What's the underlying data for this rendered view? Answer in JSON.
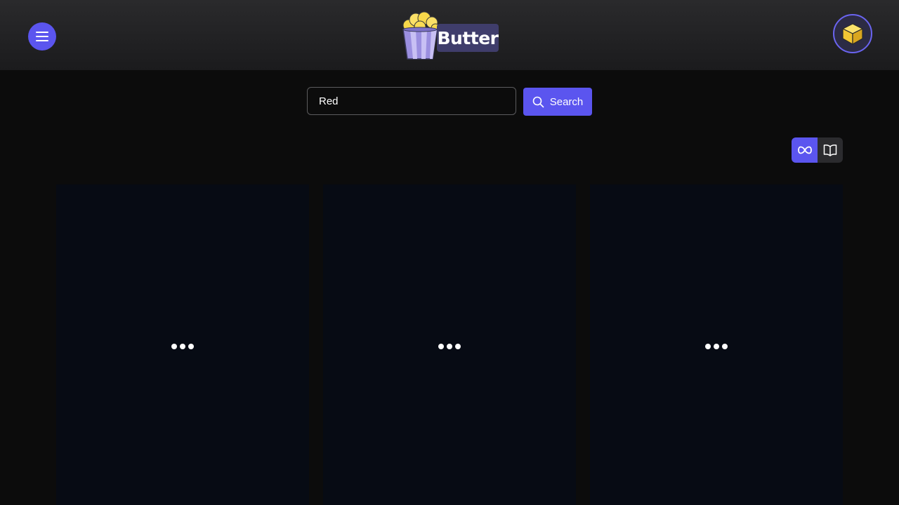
{
  "header": {
    "brand": "Butter",
    "menu_icon": "hamburger-menu-icon",
    "logo_icon": "popcorn-bucket-icon",
    "profile_icon": "cube-icon"
  },
  "search": {
    "value": "Red",
    "placeholder": "",
    "button_label": "Search",
    "button_icon": "search-icon"
  },
  "view_modes": [
    {
      "name": "infinite-scroll",
      "icon": "infinity-icon",
      "active": true
    },
    {
      "name": "paged",
      "icon": "book-icon",
      "active": false
    }
  ],
  "results": {
    "cards": [
      {
        "state": "loading"
      },
      {
        "state": "loading"
      },
      {
        "state": "loading"
      }
    ]
  },
  "colors": {
    "accent": "#5b55ef",
    "background": "#0c0c0c",
    "card": "#070b14"
  }
}
